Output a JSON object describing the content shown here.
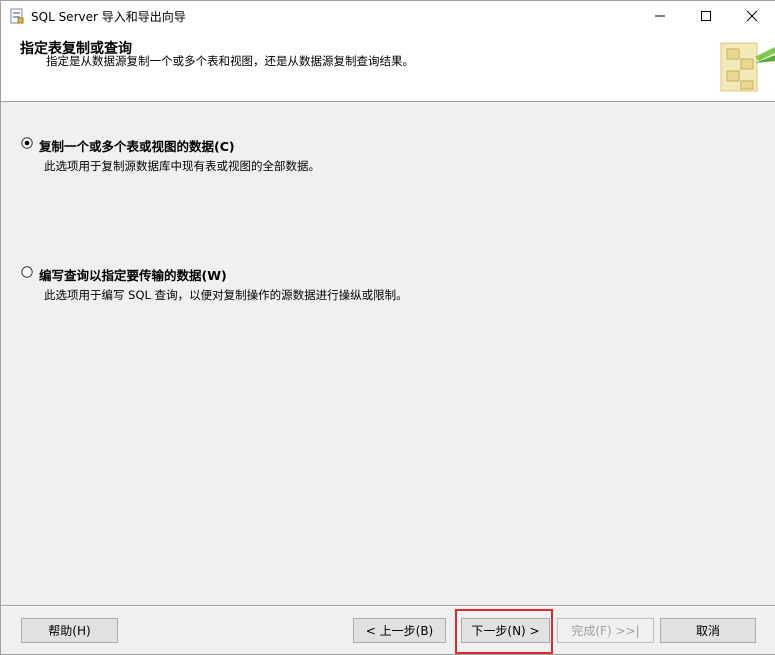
{
  "window": {
    "title": "SQL Server 导入和导出向导",
    "controls": {
      "minimize": "—",
      "maximize": "☐",
      "close": "✕"
    }
  },
  "header": {
    "title": "指定表复制或查询",
    "subtitle": "指定是从数据源复制一个或多个表和视图，还是从数据源复制查询结果。"
  },
  "options": [
    {
      "label": "复制一个或多个表或视图的数据(C)",
      "description": "此选项用于复制源数据库中现有表或视图的全部数据。",
      "selected": true
    },
    {
      "label": "编写查询以指定要传输的数据(W)",
      "description": "此选项用于编写 SQL 查询，以便对复制操作的源数据进行操纵或限制。",
      "selected": false
    }
  ],
  "buttons": {
    "help": "帮助(H)",
    "back": "< 上一步(B)",
    "next": "下一步(N) >",
    "finish": "完成(F) >>|",
    "cancel": "取消"
  },
  "colors": {
    "highlight": "#e0292e",
    "window_bg": "#f0f0f0",
    "header_bg": "#ffffff"
  }
}
